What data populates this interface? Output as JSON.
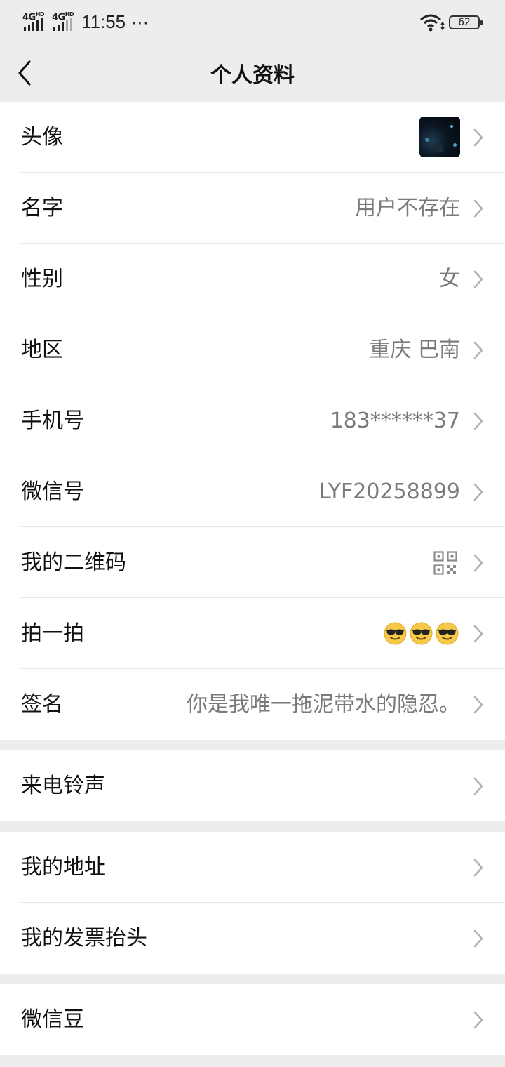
{
  "status": {
    "network1": "4G",
    "network2": "4G",
    "hd": "HD",
    "time": "11:55 ···",
    "battery": "62"
  },
  "nav": {
    "title": "个人资料"
  },
  "profile": {
    "avatar_label": "头像",
    "name_label": "名字",
    "name_value": "用户不存在",
    "gender_label": "性别",
    "gender_value": "女",
    "region_label": "地区",
    "region_value": "重庆 巴南",
    "phone_label": "手机号",
    "phone_value": "183******37",
    "wechat_id_label": "微信号",
    "wechat_id_value": "LYF20258899",
    "qr_label": "我的二维码",
    "pat_label": "拍一拍",
    "signature_label": "签名",
    "signature_value": "你是我唯一拖泥带水的隐忍。"
  },
  "ringtone": {
    "label": "来电铃声"
  },
  "address": {
    "address_label": "我的地址",
    "invoice_label": "我的发票抬头"
  },
  "beans": {
    "label": "微信豆"
  },
  "icons": {
    "back": "chevron-left-icon",
    "chevron": "chevron-right-icon",
    "qr": "qr-code-icon",
    "emoji": "sunglasses-emoji-icon"
  }
}
